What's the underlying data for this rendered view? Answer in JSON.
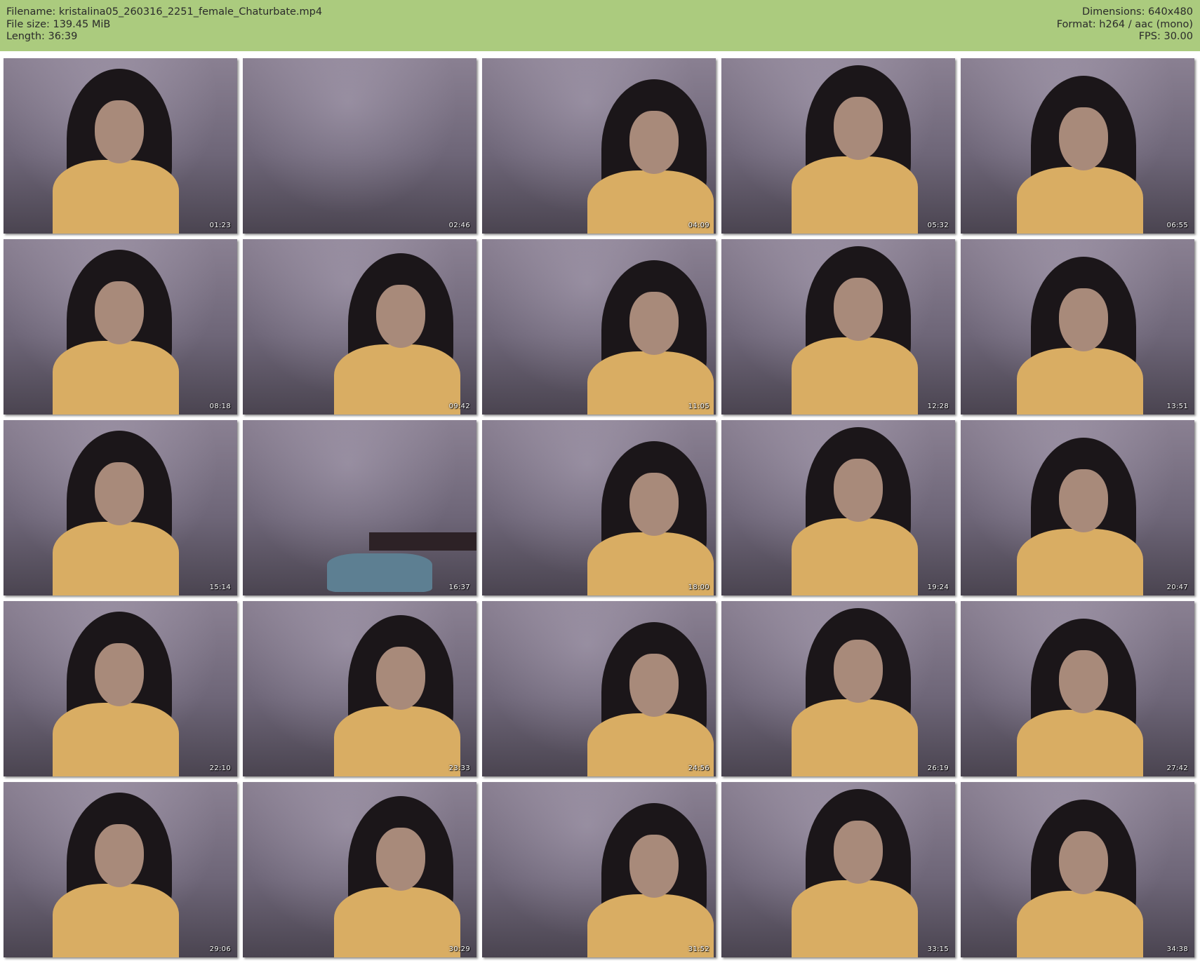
{
  "header": {
    "filename": "Filename: kristalina05_260316_2251_female_Chaturbate.mp4",
    "filesize": "File size: 139.45 MiB",
    "length": "Length: 36:39",
    "dimensions": "Dimensions: 640x480",
    "format": "Format: h264 / aac (mono)",
    "fps": "FPS: 30.00",
    "background_color": "#abcb7e"
  },
  "thumbnails": [
    {
      "time": "01:23",
      "scene": "person"
    },
    {
      "time": "02:46",
      "scene": "empty"
    },
    {
      "time": "04:09",
      "scene": "person"
    },
    {
      "time": "05:32",
      "scene": "person"
    },
    {
      "time": "06:55",
      "scene": "person"
    },
    {
      "time": "08:18",
      "scene": "person"
    },
    {
      "time": "09:42",
      "scene": "person"
    },
    {
      "time": "11:05",
      "scene": "person"
    },
    {
      "time": "12:28",
      "scene": "person"
    },
    {
      "time": "13:51",
      "scene": "person"
    },
    {
      "time": "15:14",
      "scene": "person"
    },
    {
      "time": "16:37",
      "scene": "empty-bed"
    },
    {
      "time": "18:00",
      "scene": "person"
    },
    {
      "time": "19:24",
      "scene": "person"
    },
    {
      "time": "20:47",
      "scene": "person"
    },
    {
      "time": "22:10",
      "scene": "person"
    },
    {
      "time": "23:33",
      "scene": "person"
    },
    {
      "time": "24:56",
      "scene": "person"
    },
    {
      "time": "26:19",
      "scene": "person"
    },
    {
      "time": "27:42",
      "scene": "person"
    },
    {
      "time": "29:06",
      "scene": "person"
    },
    {
      "time": "30:29",
      "scene": "person"
    },
    {
      "time": "31:52",
      "scene": "person"
    },
    {
      "time": "33:15",
      "scene": "person"
    },
    {
      "time": "34:38",
      "scene": "person"
    }
  ]
}
